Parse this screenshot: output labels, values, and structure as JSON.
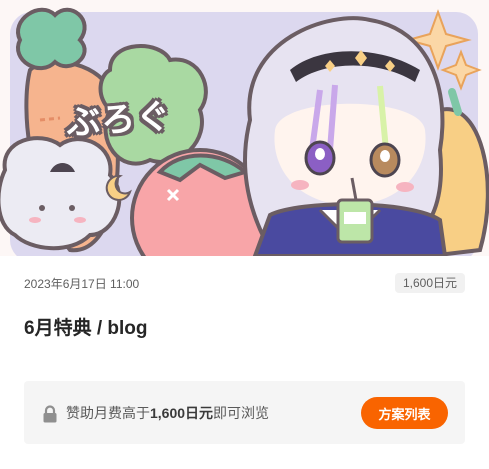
{
  "post": {
    "image_title": "ぶろぐ",
    "date": "2023年6月17日 11:00",
    "price_badge": "1,600日元",
    "title": "6月特典 / blog"
  },
  "lock_notice": {
    "prefix": "赞助月费高于",
    "amount": "1,600日元",
    "suffix": "即可浏览",
    "icon": "lock-icon",
    "button_label": "方案列表"
  },
  "colors": {
    "accent": "#f96400",
    "panel_bg": "#f5f5f5"
  }
}
